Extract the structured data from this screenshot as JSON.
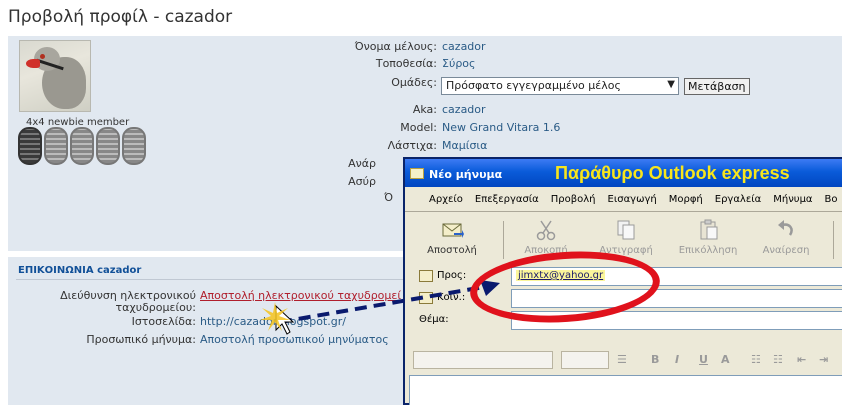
{
  "page_title": "Προβολή προφίλ - cazador",
  "profile": {
    "rank_label": "4x4 newbie member",
    "fields": [
      {
        "label": "Όνομα μέλους:",
        "value": "cazador"
      },
      {
        "label": "Τοποθεσία:",
        "value": "Σύρος"
      },
      {
        "label": "Ομάδες:",
        "value": ""
      },
      {
        "label": "Aka:",
        "value": "cazador"
      },
      {
        "label": "Model:",
        "value": "New Grand Vitara 1.6"
      },
      {
        "label": "Λάστιχα:",
        "value": "Μαμίσια"
      },
      {
        "label": "Ανάρ",
        "value": ""
      },
      {
        "label": "Ασύρ",
        "value": ""
      },
      {
        "label": "Ό",
        "value": ""
      }
    ],
    "groups_select": "Πρόσφατο εγγεγραμμένο μέλος",
    "go_button": "Μετάβαση"
  },
  "contact": {
    "header": "ΕΠΙΚΟΙΝΩΝΙΑ cazador",
    "email_label_1": "Διεύθυνση ηλεκτρονικού",
    "email_label_2": "ταχυδρομείου:",
    "email_link": "Αποστολή ηλεκτρονικού ταχυδρομεί",
    "website_label": "Ιστοσελίδα:",
    "website_value": "http://cazador.blogspot.gr/",
    "pm_label": "Προσωπικό μήνυμα:",
    "pm_link": "Αποστολή προσωπικού μηνύματος"
  },
  "outlook": {
    "window_title": "Νέο μήνυμα",
    "banner": "Παράθυρο Outlook express",
    "menu": [
      "Αρχείο",
      "Επεξεργασία",
      "Προβολή",
      "Εισαγωγή",
      "Μορφή",
      "Εργαλεία",
      "Μήνυμα",
      "Βο"
    ],
    "toolbar": {
      "send": "Αποστολή",
      "cut": "Αποκοπή",
      "copy": "Αντιγραφή",
      "paste": "Επικόλληση",
      "undo": "Αναίρεση"
    },
    "to_label": "Προς:",
    "cc_label": "Κοιν.:",
    "subject_label": "Θέμα:",
    "to_value": "jimxtx@yahoo.gr",
    "format_glyphs": [
      "B",
      "I",
      "U",
      "A"
    ]
  },
  "colors": {
    "panel_bg": "#e1e8f0",
    "link_blue": "#2a5b86",
    "email_red": "#b01e2c",
    "annotation_red": "#e0121c",
    "arrow_navy": "#0a1a6e",
    "banner_yellow": "#f7e51c"
  }
}
